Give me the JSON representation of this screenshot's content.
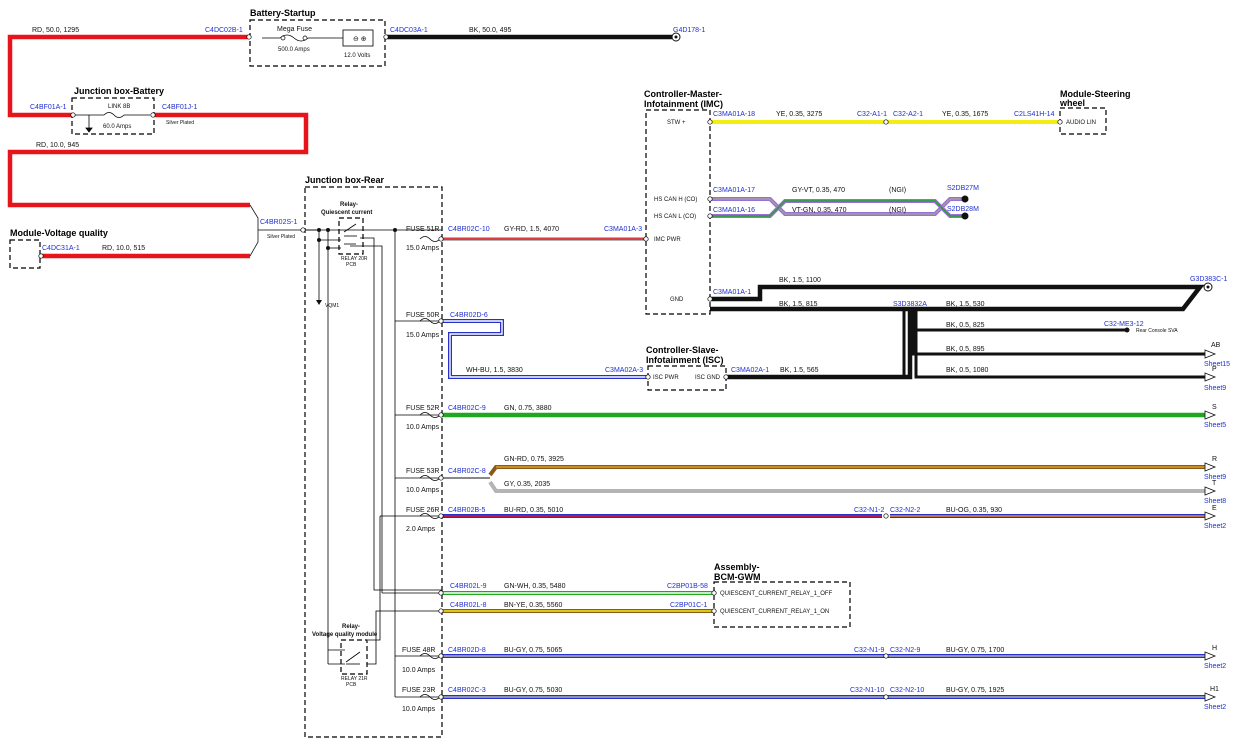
{
  "boxes": {
    "battery": "Battery-Startup",
    "jb_battery": "Junction box-Battery",
    "voltage": "Module-Voltage quality",
    "jb_rear": "Junction box-Rear",
    "relay_q": [
      "Relay-",
      "Quiescent current"
    ],
    "relay_v": [
      "Relay-",
      "Voltage quality module"
    ],
    "imc": [
      "Controller-Master-",
      "Infotainment (IMC)"
    ],
    "isc": [
      "Controller-Slave-",
      "Infotainment (ISC)"
    ],
    "steering": [
      "Module-Steering",
      "wheel"
    ],
    "bcm": [
      "Assembly-",
      "BCM-GWM"
    ]
  },
  "parts": {
    "mega_fuse": "Mega Fuse",
    "mega_amps": "500.0 Amps",
    "batt_volts": "12.0 Volts",
    "link": "LINK 8B",
    "link_amps": "60.0 Amps",
    "silver1": "Silver Plated",
    "silver2": "Silver Plated",
    "relay20": [
      "RELAY 20R",
      "PCB"
    ],
    "relay21": [
      "RELAY 21R",
      "PCB"
    ],
    "vqm": "VQM1"
  },
  "fuses": [
    {
      "name": "FUSE 51R",
      "amps": "15.0 Amps"
    },
    {
      "name": "FUSE 50R",
      "amps": "15.0 Amps"
    },
    {
      "name": "FUSE 52R",
      "amps": "10.0 Amps"
    },
    {
      "name": "FUSE 53R",
      "amps": "10.0 Amps"
    },
    {
      "name": "FUSE 26R",
      "amps": "2.0 Amps"
    },
    {
      "name": "FUSE 48R",
      "amps": "10.0 Amps"
    },
    {
      "name": "FUSE 23R",
      "amps": "10.0 Amps"
    }
  ],
  "connectors": {
    "c4dc02b": "C4DC02B-1",
    "c4dc03a": "C4DC03A-1",
    "g4d178": "G4D178-1",
    "c4bf01a": "C4BF01A-1",
    "c4bf01j": "C4BF01J-1",
    "c4br02s": "C4BR02S-1",
    "c4dc31a": "C4DC31A-1",
    "c4br02c10": "C4BR02C-10",
    "c3ma01a3": "C3MA01A-3",
    "c4br02d6": "C4BR02D-6",
    "c3ma02a3": "C3MA02A-3",
    "c3ma02a1": "C3MA02A-1",
    "c3ma01a18": "C3MA01A-18",
    "c32a11": "C32-A1-1",
    "c32a21": "C32-A2-1",
    "c2ls41h14": "C2LS41H-14",
    "c3ma01a17": "C3MA01A-17",
    "c3ma01a16": "C3MA01A-16",
    "s2db27m": "S2DB27M",
    "s2db28m": "S2DB28M",
    "c3ma01a1": "C3MA01A-1",
    "g3d383c": "G3D383C-1",
    "s3d3832a": "S3D3832A",
    "c32me312": "C32-ME3-12",
    "c4br02c9": "C4BR02C-9",
    "c4br02c8": "C4BR02C-8",
    "c4br02b5": "C4BR02B-5",
    "c32n12": "C32-N1-2",
    "c32n22": "C32-N2-2",
    "c4br02l9": "C4BR02L-9",
    "c2bp01b58": "C2BP01B-58",
    "c4br02l8": "C4BR02L-8",
    "c2bp01c1": "C2BP01C-1",
    "c4br02d8": "C4BR02D-8",
    "c32n19": "C32-N1-9",
    "c32n29": "C32-N2-9",
    "c4br02c3": "C4BR02C-3",
    "c32n110": "C32-N1-10",
    "c32n210": "C32-N2-10"
  },
  "pins": {
    "stw": "STW +",
    "audio_lin": "AUDIO LIN",
    "hs_can_h": "HS CAN H (CO)",
    "hs_can_l": "HS CAN L (CO)",
    "imc_pwr": "IMC PWR",
    "gnd": "GND",
    "isc_pwr": "ISC PWR",
    "isc_gnd": "ISC GND",
    "bcm_off": "QUIESCENT_CURRENT_RELAY_1_OFF",
    "bcm_on": "QUIESCENT_CURRENT_RELAY_1_ON",
    "rear_console": "Rear Console SVA"
  },
  "wires": {
    "w1295": "RD,  50.0,  1295",
    "w495": "BK,  50.0,  495",
    "w945": "RD,  10.0,  945",
    "w515": "RD,  10.0,  515",
    "w4070": "GY-RD,  1.5,  4070",
    "w3830": "WH-BU,  1.5,  3830",
    "w3275": "YE,  0.35,  3275",
    "w1675": "YE,  0.35,  1675",
    "w470a": "GY-VT,  0.35,  470",
    "w470b": "VT-GN,  0.35,  470",
    "ngi1": "(NGI)",
    "ngi2": "(NGI)",
    "w1100": "BK,  1.5,  1100",
    "w815": "BK,  1.5,  815",
    "w530": "BK,  1.5,  530",
    "w825": "BK,  0.5,  825",
    "w895": "BK,  0.5,  895",
    "w565": "BK,  1.5,  565",
    "w1080": "BK,  0.5,  1080",
    "w3880": "GN,  0.75,  3880",
    "w3925": "GN-RD,  0.75,  3925",
    "w2035": "GY,  0.35,  2035",
    "w5010": "BU-RD,  0.35,  5010",
    "w930": "BU-OG,  0.35,  930",
    "w5480": "GN-WH,  0.35,  5480",
    "w5560": "BN-YE,  0.35,  5560",
    "w5065": "BU-GY,  0.75,  5065",
    "w1700": "BU-GY,  0.75,  1700",
    "w5030": "BU-GY,  0.75,  5030",
    "w1925": "BU-GY,  0.75,  1925"
  },
  "offsheet": [
    {
      "letter": "AB",
      "sheet": "Sheet15"
    },
    {
      "letter": "P",
      "sheet": "Sheet9"
    },
    {
      "letter": "S",
      "sheet": "Sheet5"
    },
    {
      "letter": "R",
      "sheet": "Sheet9"
    },
    {
      "letter": "T",
      "sheet": "Sheet8"
    },
    {
      "letter": "E",
      "sheet": "Sheet2"
    },
    {
      "letter": "H",
      "sheet": "Sheet2"
    },
    {
      "letter": "H1",
      "sheet": "Sheet2"
    }
  ],
  "colors": {
    "red": "#e8141b",
    "black": "#111111",
    "yellow": "#f2ee14",
    "green": "#1fa81f",
    "blue": "#2730c8",
    "gray": "#b4b4b4",
    "violet": "#9a6fd6",
    "orange": "#f08a1c",
    "brown": "#8a5a1c"
  }
}
